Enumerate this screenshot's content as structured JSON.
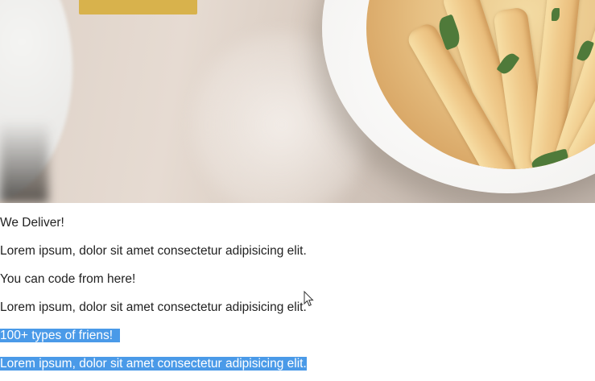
{
  "content": {
    "sections": [
      {
        "heading": "We Deliver!",
        "text": "Lorem ipsum, dolor sit amet consectetur adipisicing elit."
      },
      {
        "heading": "You can code from here!",
        "text": "Lorem ipsum, dolor sit amet consectetur adipisicing elit."
      },
      {
        "heading": "100+ types of friens!",
        "text": "Lorem ipsum, dolor sit amet consectetur adipisicing elit."
      }
    ]
  },
  "colors": {
    "selection": "#4a9ae8",
    "button_accent": "#d8b24c",
    "text": "#222222"
  },
  "icons": {
    "cursor": "mouse-pointer-icon"
  }
}
